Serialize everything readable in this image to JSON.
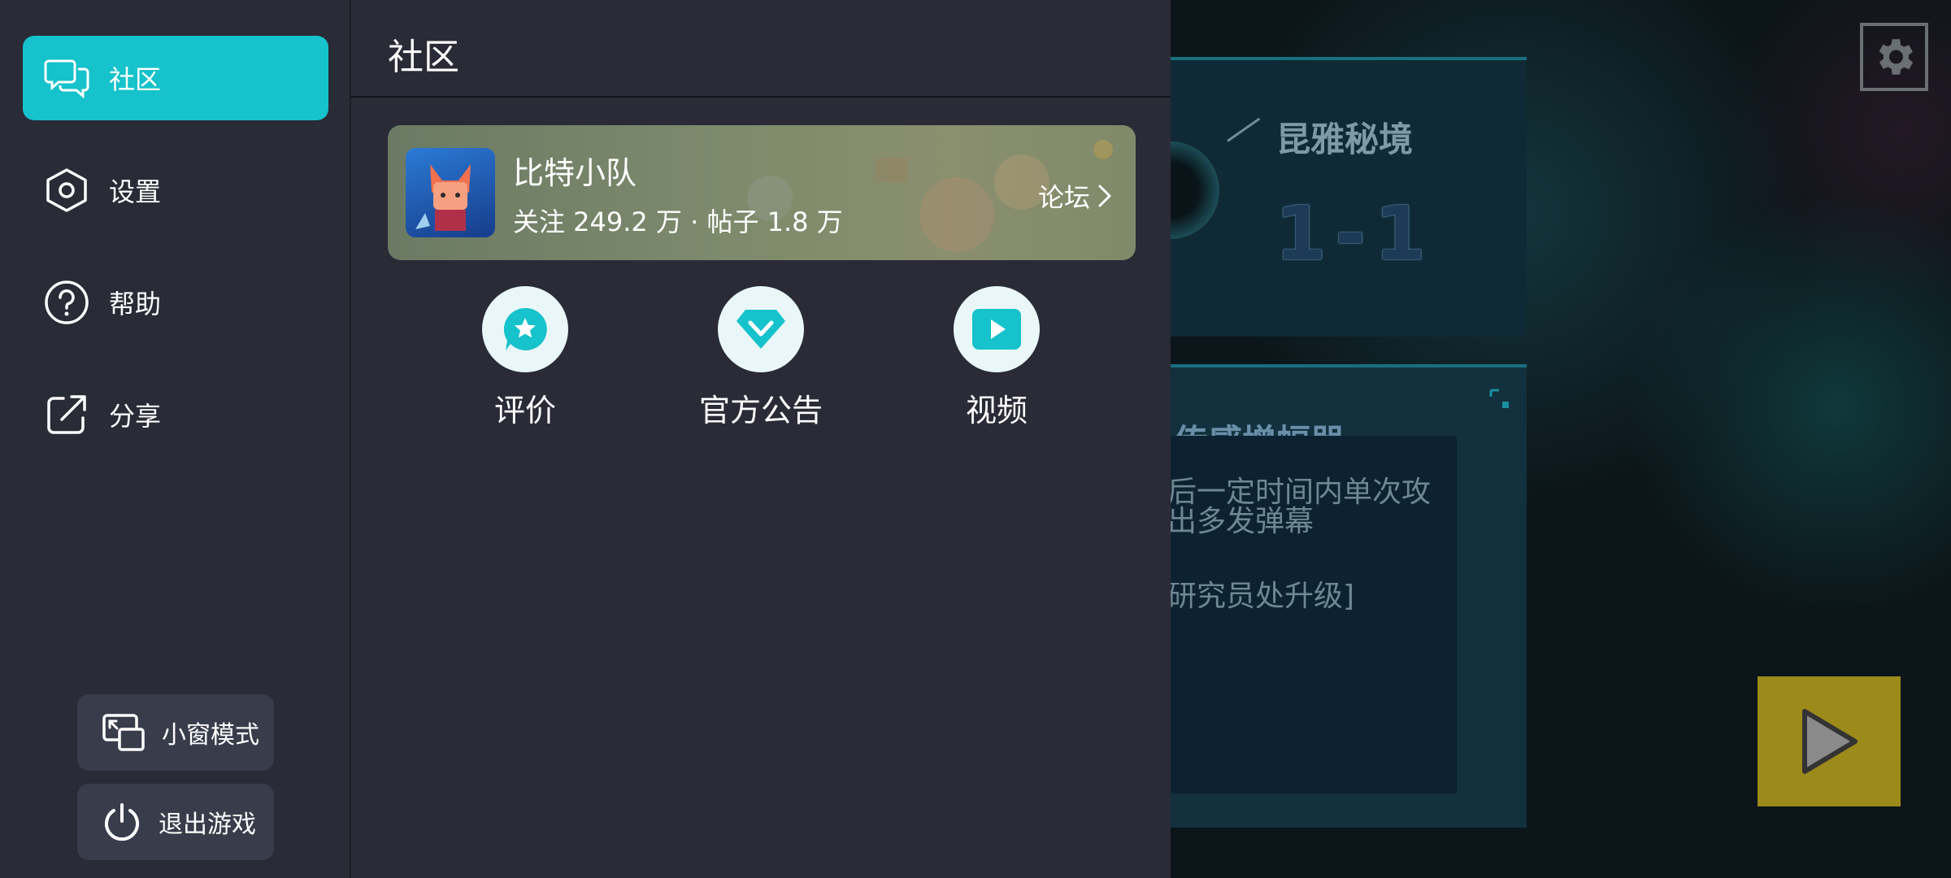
{
  "sidebar": {
    "items": [
      {
        "label": "社区",
        "icon": "chat-icon",
        "active": true
      },
      {
        "label": "设置",
        "icon": "hexagon-settings-icon",
        "active": false
      },
      {
        "label": "帮助",
        "icon": "help-icon",
        "active": false
      },
      {
        "label": "分享",
        "icon": "share-icon",
        "active": false
      }
    ],
    "mini_window_label": "小窗模式",
    "exit_label": "退出游戏"
  },
  "panel": {
    "title": "社区",
    "game_card": {
      "name": "比特小队",
      "stats": "关注 249.2 万 · 帖子 1.8 万",
      "forum_label": "论坛"
    },
    "actions": [
      {
        "label": "评价",
        "icon": "star-badge-icon"
      },
      {
        "label": "官方公告",
        "icon": "diamond-icon"
      },
      {
        "label": "视频",
        "icon": "play-video-icon"
      }
    ]
  },
  "game": {
    "level_name": "昆雅秘境",
    "level_number": "1-1",
    "item_title": "传感增幅器",
    "item_desc": "后一定时间内单次攻出多发弹幕",
    "item_note": "研究员处升级]"
  },
  "colors": {
    "accent": "#16c2cb",
    "sidebar_bg": "#292b36",
    "panel_bg": "#2a2b37",
    "button_bg": "#393c4b"
  }
}
